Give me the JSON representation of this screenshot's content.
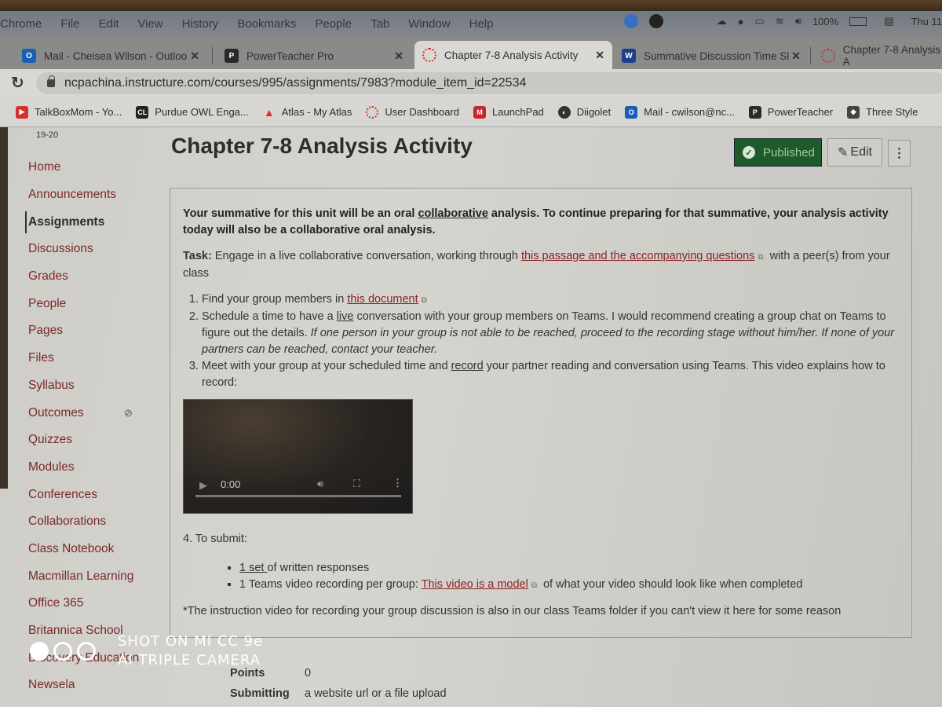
{
  "menubar": {
    "items": [
      "Chrome",
      "File",
      "Edit",
      "View",
      "History",
      "Bookmarks",
      "People",
      "Tab",
      "Window",
      "Help"
    ],
    "battery": "100%",
    "clock": "Thu 11"
  },
  "tabs": [
    {
      "label": "Mail - Cheisea Wilson - Outloo",
      "icon": "outlook-icon",
      "color": "#1a5fb4"
    },
    {
      "label": "PowerTeacher Pro",
      "icon": "powerteacher-icon",
      "color": "#2a2a2a"
    },
    {
      "label": "Chapter 7-8 Analysis Activity",
      "icon": "canvas-icon",
      "color": "#c0392b",
      "active": true
    },
    {
      "label": "Summative Discussion Time Sl",
      "icon": "word-icon",
      "color": "#1f3f8a"
    },
    {
      "label": "Chapter 7-8 Analysis A",
      "icon": "canvas-icon",
      "color": "#c0392b"
    }
  ],
  "address": {
    "url": "ncpachina.instructure.com/courses/995/assignments/7983?module_item_id=22534"
  },
  "bookmarks": [
    {
      "label": "TalkBoxMom - Yo...",
      "icon": "youtube-icon",
      "color": "#d32f2f"
    },
    {
      "label": "Purdue OWL Enga...",
      "icon": "purdue-owl-icon",
      "color": "#222"
    },
    {
      "label": "Atlas - My Atlas",
      "icon": "atlas-icon",
      "color": "#d6332c"
    },
    {
      "label": "User Dashboard",
      "icon": "canvas-icon",
      "color": "#c0392b"
    },
    {
      "label": "LaunchPad",
      "icon": "launchpad-icon",
      "color": "#c62828"
    },
    {
      "label": "Diigolet",
      "icon": "diigolet-icon",
      "color": "#333"
    },
    {
      "label": "Mail - cwilson@nc...",
      "icon": "outlook-icon",
      "color": "#1a5fb4"
    },
    {
      "label": "PowerTeacher",
      "icon": "powerteacher-icon",
      "color": "#2a2a2a"
    },
    {
      "label": "Three Style",
      "icon": "shield-icon",
      "color": "#444"
    }
  ],
  "sidebar": {
    "term": "19-20",
    "items": [
      {
        "label": "Home"
      },
      {
        "label": "Announcements"
      },
      {
        "label": "Assignments",
        "active": true
      },
      {
        "label": "Discussions"
      },
      {
        "label": "Grades"
      },
      {
        "label": "People"
      },
      {
        "label": "Pages"
      },
      {
        "label": "Files"
      },
      {
        "label": "Syllabus"
      },
      {
        "label": "Outcomes",
        "hidden_icon": true
      },
      {
        "label": "Quizzes"
      },
      {
        "label": "Modules"
      },
      {
        "label": "Conferences"
      },
      {
        "label": "Collaborations"
      },
      {
        "label": "Class Notebook"
      },
      {
        "label": "Macmillan Learning"
      },
      {
        "label": "Office 365"
      },
      {
        "label": "Britannica School"
      },
      {
        "label": "Discovery Education"
      },
      {
        "label": "Newsela"
      }
    ]
  },
  "assignment": {
    "title": "Chapter 7-8 Analysis Activity",
    "published_label": "Published",
    "edit_label": "Edit",
    "more_label": "⋮",
    "intro_a": "Your summative for this unit will be an oral ",
    "intro_u": "collaborative",
    "intro_b": " analysis. To continue preparing for that summative, your analysis activity today will also be a collaborative oral analysis.",
    "task_label": "Task:",
    "task_a": " Engage in a live collaborative conversation, working through ",
    "task_link": "this passage and the accompanying questions",
    "task_b": " with a peer(s) from your class",
    "step1_a": "Find your group members in ",
    "step1_link": "this document",
    "step2_a": "Schedule a time to have a ",
    "step2_u": "live",
    "step2_b": " conversation with your group members on Teams. I would recommend creating a group chat on Teams to figure out the details. ",
    "step2_i": "If one person in your group is not able to be reached, proceed to the recording stage without him/her. If none of your partners can be reached, contact your teacher.",
    "step3_a": "Meet with your group at your scheduled time and ",
    "step3_u": "record",
    "step3_b": " your partner reading and conversation using Teams. This video explains how to record:",
    "video_time": "0:00",
    "video_progress": 0,
    "submit_head": "4. To submit:",
    "sub1_u": "1 set ",
    "sub1_b": "of written responses",
    "sub2_a": "1 Teams video recording per group: ",
    "sub2_link": "This video is a model",
    "sub2_b": " of what your video should look like when completed",
    "note": "*The instruction video for recording your group discussion is also in our class Teams folder if you can't view it here for some reason",
    "points_label": "Points",
    "points_value": "0",
    "submitting_label": "Submitting",
    "submitting_value": "a website url or a file upload"
  },
  "watermark": {
    "line1": "SHOT ON MI CC 9e",
    "line2": "AI TRIPLE CAMERA"
  },
  "colors": {
    "published_bg": "#1f5a2c",
    "link": "#8b2323",
    "nav_link": "#7a2a2a"
  }
}
